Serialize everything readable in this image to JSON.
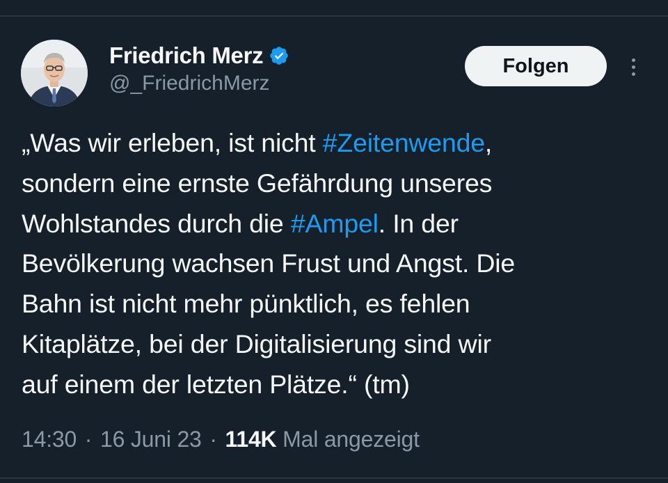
{
  "author": {
    "display_name": "Friedrich Merz",
    "handle": "@_FriedrichMerz",
    "verified_color": "#1d9bf0"
  },
  "actions": {
    "follow_label": "Folgen",
    "more_icon": "more-vertical-icon"
  },
  "tweet": {
    "lines": [
      [
        {
          "text": "„Was wir erleben, ist nicht "
        },
        {
          "text": "#Zeitenwende",
          "hashtag": true
        },
        {
          "text": ","
        }
      ],
      [
        {
          "text": "sondern eine ernste Gefährdung unseres"
        }
      ],
      [
        {
          "text": "Wohlstandes durch die "
        },
        {
          "text": "#Ampel",
          "hashtag": true
        },
        {
          "text": ". In der"
        }
      ],
      [
        {
          "text": "Bevölkerung wachsen Frust und Angst. Die"
        }
      ],
      [
        {
          "text": "Bahn ist nicht mehr pünktlich, es fehlen"
        }
      ],
      [
        {
          "text": "Kitaplätze, bei der Digitalisierung sind wir"
        }
      ],
      [
        {
          "text": "auf einem der letzten Plätze.“ (tm)"
        }
      ]
    ]
  },
  "meta": {
    "time": "14:30",
    "date": "16 Juni 23",
    "views_count": "114K",
    "views_label": "Mal angezeigt",
    "separator": "·"
  },
  "colors": {
    "background": "#15202b",
    "text": "#f7f9f9",
    "secondary": "#8b98a5",
    "link": "#1d9bf0"
  }
}
